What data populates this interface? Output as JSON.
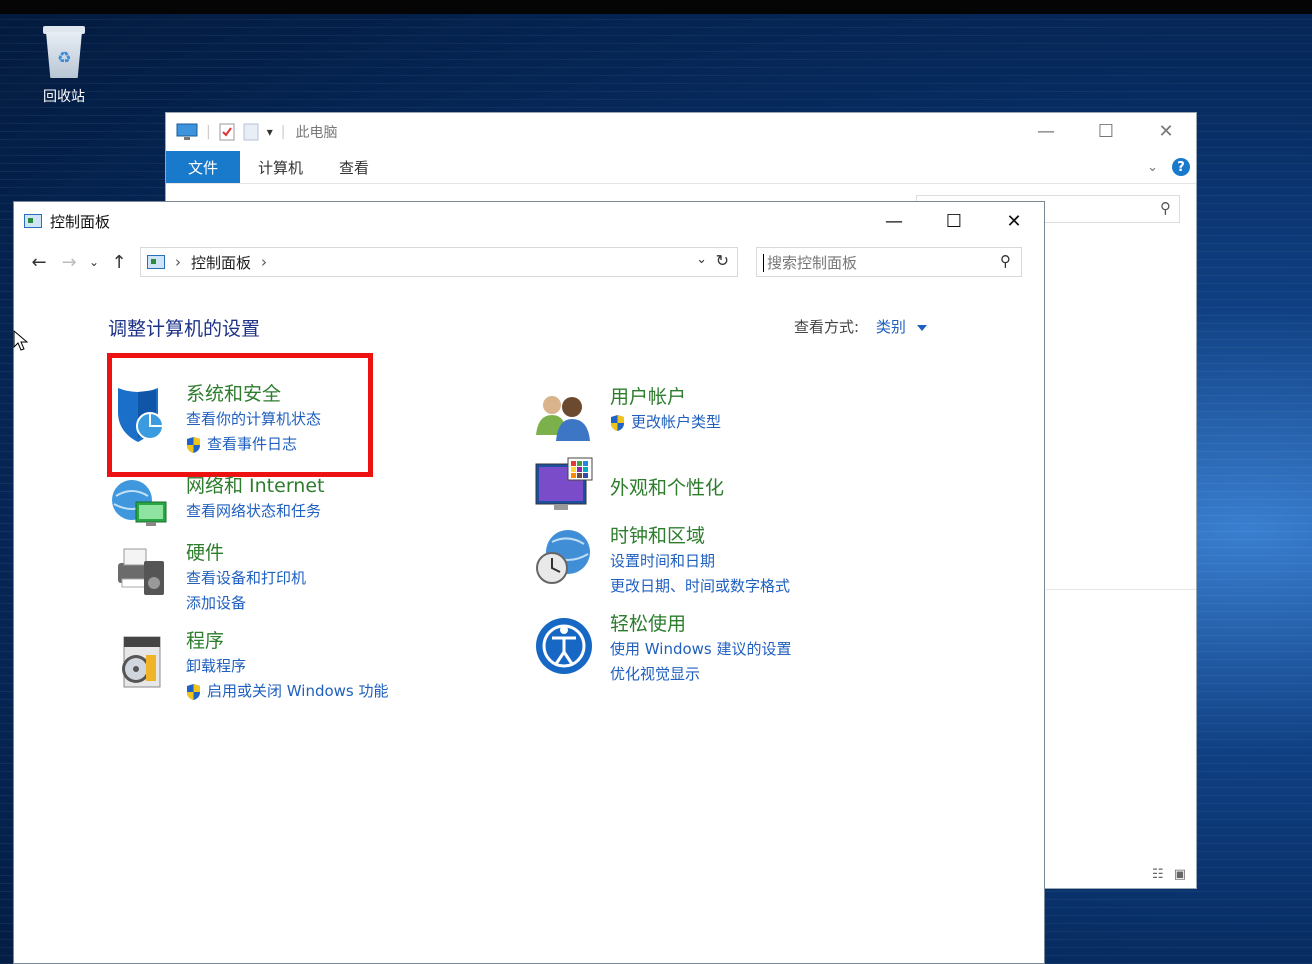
{
  "desktop": {
    "recycle_bin_label": "回收站"
  },
  "explorer": {
    "title": "此电脑",
    "ribbon_tabs": [
      "文件",
      "计算机",
      "查看"
    ]
  },
  "control_panel": {
    "title": "控制面板",
    "address_crumb": "控制面板",
    "search_placeholder": "搜索控制面板",
    "heading": "调整计算机的设置",
    "view_by_label": "查看方式:",
    "view_by_value": "类别",
    "categories": [
      {
        "title": "系统和安全",
        "links": [
          {
            "text": "查看你的计算机状态",
            "shield": false
          },
          {
            "text": "查看事件日志",
            "shield": true
          }
        ]
      },
      {
        "title": "网络和 Internet",
        "links": [
          {
            "text": "查看网络状态和任务",
            "shield": false
          }
        ]
      },
      {
        "title": "硬件",
        "links": [
          {
            "text": "查看设备和打印机",
            "shield": false
          },
          {
            "text": "添加设备",
            "shield": false
          }
        ]
      },
      {
        "title": "程序",
        "links": [
          {
            "text": "卸载程序",
            "shield": false
          },
          {
            "text": "启用或关闭 Windows 功能",
            "shield": true
          }
        ]
      },
      {
        "title": "用户帐户",
        "links": [
          {
            "text": "更改帐户类型",
            "shield": true
          }
        ]
      },
      {
        "title": "外观和个性化",
        "links": []
      },
      {
        "title": "时钟和区域",
        "links": [
          {
            "text": "设置时间和日期",
            "shield": false
          },
          {
            "text": "更改日期、时间或数字格式",
            "shield": false
          }
        ]
      },
      {
        "title": "轻松使用",
        "links": [
          {
            "text": "使用 Windows 建议的设置",
            "shield": false
          },
          {
            "text": "优化视觉显示",
            "shield": false
          }
        ]
      }
    ]
  },
  "colors": {
    "accent": "#1979ca",
    "category_green": "#2d7d2d",
    "link_blue": "#1f5fbf",
    "highlight_red": "#ee1111"
  }
}
